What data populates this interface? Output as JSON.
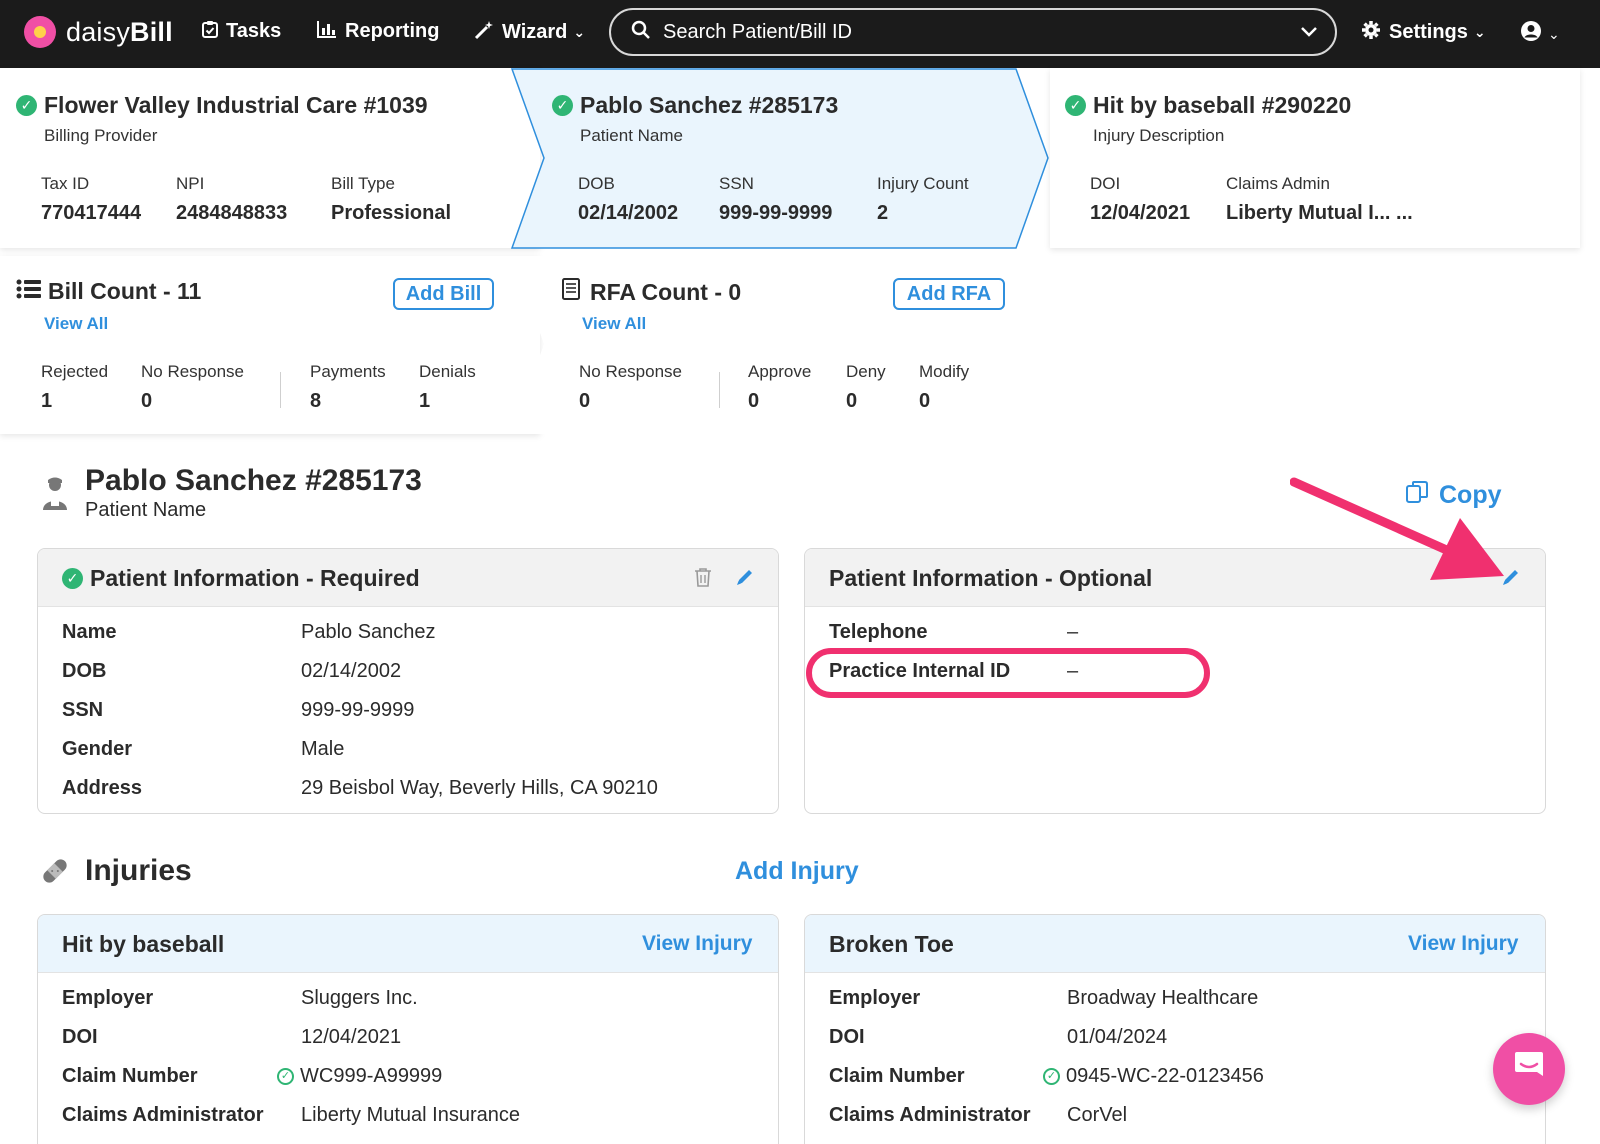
{
  "nav": {
    "logo_text_light": "daisy",
    "logo_text_bold": "Bill",
    "tasks": "Tasks",
    "reporting": "Reporting",
    "wizard": "Wizard",
    "search_placeholder": "Search Patient/Bill ID",
    "settings": "Settings"
  },
  "provider_card": {
    "title": "Flower Valley Industrial Care #1039",
    "subtitle": "Billing Provider",
    "fields": [
      {
        "label": "Tax ID",
        "value": "770417444"
      },
      {
        "label": "NPI",
        "value": "2484848833"
      },
      {
        "label": "Bill Type",
        "value": "Professional"
      }
    ]
  },
  "patient_card": {
    "title": "Pablo Sanchez #285173",
    "subtitle": "Patient Name",
    "fields": [
      {
        "label": "DOB",
        "value": "02/14/2002"
      },
      {
        "label": "SSN",
        "value": "999-99-9999"
      },
      {
        "label": "Injury Count",
        "value": "2"
      }
    ]
  },
  "injury_card": {
    "title": "Hit by baseball #290220",
    "subtitle": "Injury Description",
    "fields": [
      {
        "label": "DOI",
        "value": "12/04/2021"
      },
      {
        "label": "Claims Admin",
        "value": "Liberty Mutual I... ..."
      }
    ]
  },
  "bill_card": {
    "title": "Bill Count - 11",
    "view_all": "View All",
    "add_button": "Add Bill",
    "stats": [
      {
        "label": "Rejected",
        "value": "1"
      },
      {
        "label": "No Response",
        "value": "0"
      },
      {
        "label": "Payments",
        "value": "8"
      },
      {
        "label": "Denials",
        "value": "1"
      }
    ]
  },
  "rfa_card": {
    "title": "RFA Count - 0",
    "view_all": "View All",
    "add_button": "Add RFA",
    "stats": [
      {
        "label": "No Response",
        "value": "0"
      },
      {
        "label": "Approve",
        "value": "0"
      },
      {
        "label": "Deny",
        "value": "0"
      },
      {
        "label": "Modify",
        "value": "0"
      }
    ]
  },
  "patient_header": {
    "title": "Pablo Sanchez #285173",
    "subtitle": "Patient Name",
    "copy": "Copy"
  },
  "required_panel": {
    "title": "Patient Information - Required",
    "rows": [
      {
        "label": "Name",
        "value": "Pablo Sanchez"
      },
      {
        "label": "DOB",
        "value": "02/14/2002"
      },
      {
        "label": "SSN",
        "value": "999-99-9999"
      },
      {
        "label": "Gender",
        "value": "Male"
      },
      {
        "label": "Address",
        "value": "29 Beisbol Way, Beverly Hills, CA 90210"
      }
    ]
  },
  "optional_panel": {
    "title": "Patient Information - Optional",
    "rows": [
      {
        "label": "Telephone",
        "value": "–"
      },
      {
        "label": "Practice Internal ID",
        "value": "–"
      }
    ]
  },
  "injuries": {
    "title": "Injuries",
    "add": "Add Injury",
    "view": "View Injury",
    "items": [
      {
        "title": "Hit by baseball",
        "rows": [
          {
            "label": "Employer",
            "value": "Sluggers Inc."
          },
          {
            "label": "DOI",
            "value": "12/04/2021"
          },
          {
            "label": "Claim Number",
            "value": "WC999-A99999"
          },
          {
            "label": "Claims Administrator",
            "value": "Liberty Mutual Insurance"
          }
        ]
      },
      {
        "title": "Broken Toe",
        "rows": [
          {
            "label": "Employer",
            "value": "Broadway Healthcare"
          },
          {
            "label": "DOI",
            "value": "01/04/2024"
          },
          {
            "label": "Claim Number",
            "value": "0945-WC-22-0123456"
          },
          {
            "label": "Claims Administrator",
            "value": "CorVel"
          }
        ]
      }
    ]
  },
  "colors": {
    "nav_bg": "#1b1b1b",
    "accent_blue": "#2f8fdd",
    "check_green": "#2fb574",
    "annotation_pink": "#f0306f",
    "brand_pink": "#f04fa5",
    "active_card_bg": "#eaf5fd"
  },
  "icons": [
    "daisy-logo-icon",
    "tasks-icon",
    "reporting-icon",
    "wizard-icon",
    "search-icon",
    "chevron-down-icon",
    "gear-icon",
    "user-circle-icon",
    "check-circle-icon",
    "list-icon",
    "rfa-document-icon",
    "person-icon",
    "copy-icon",
    "trash-icon",
    "pencil-icon",
    "bandage-icon",
    "chat-icon"
  ]
}
